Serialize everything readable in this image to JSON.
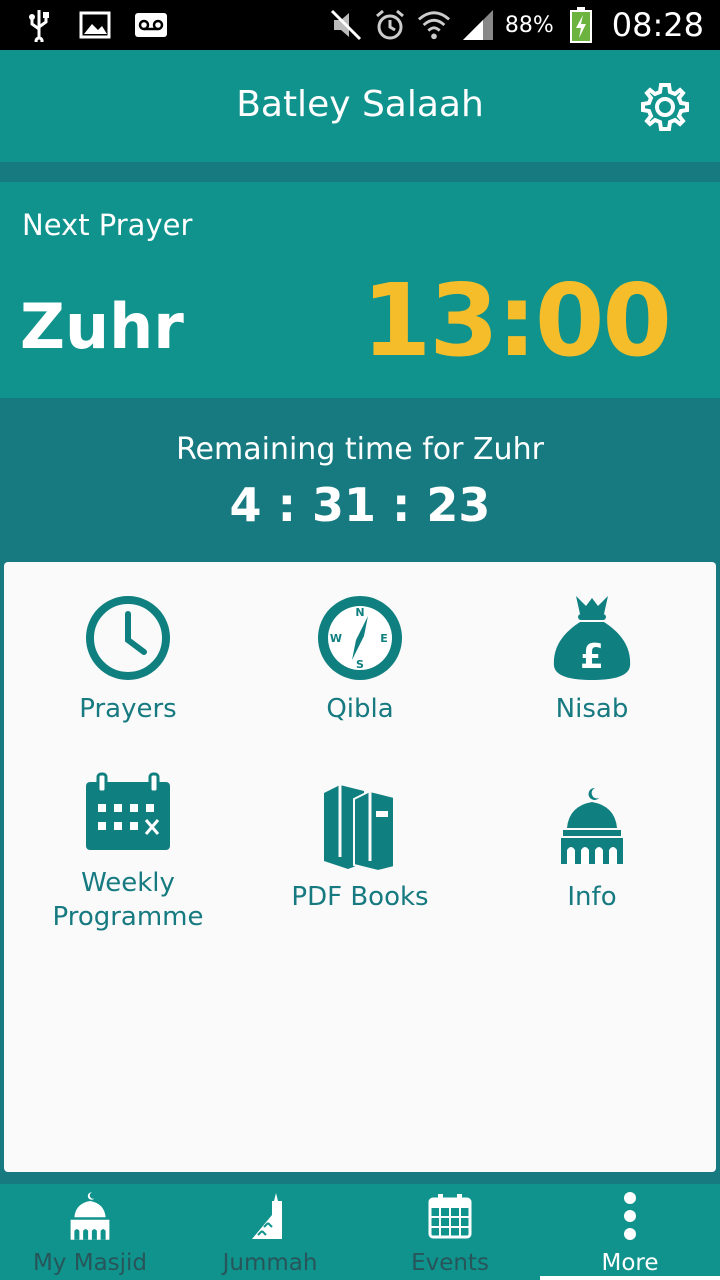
{
  "status_bar": {
    "battery": "88%",
    "time": "08:28",
    "left_icons": [
      "usb-icon",
      "image-icon",
      "voicemail-icon"
    ],
    "right_icons": [
      "mute-icon",
      "alarm-icon",
      "wifi-icon",
      "signal-icon",
      "battery-charging-icon"
    ]
  },
  "app_bar": {
    "title": "Batley Salaah",
    "settings_icon": "gear-icon"
  },
  "next_prayer": {
    "label": "Next Prayer",
    "name": "Zuhr",
    "time": "13:00"
  },
  "remaining": {
    "label": "Remaining time for Zuhr",
    "time": "4 : 31 : 23"
  },
  "tiles": [
    {
      "label": "Prayers",
      "icon": "clock-icon"
    },
    {
      "label": "Qibla",
      "icon": "compass-icon"
    },
    {
      "label": "Nisab",
      "icon": "money-bag-icon"
    },
    {
      "label": "Weekly Programme",
      "icon": "calendar-icon"
    },
    {
      "label": "PDF Books",
      "icon": "books-icon"
    },
    {
      "label": "Info",
      "icon": "mosque-icon"
    }
  ],
  "bottom_nav": [
    {
      "label": "My Masjid",
      "icon": "mosque-icon"
    },
    {
      "label": "Jummah",
      "icon": "minbar-icon"
    },
    {
      "label": "Events",
      "icon": "calendar-icon"
    },
    {
      "label": "More",
      "icon": "more-vertical-icon",
      "active": true
    }
  ],
  "colors": {
    "primary": "#0f938c",
    "primary_dark": "#167a80",
    "accent": "#f6bd2b",
    "icon": "#0f7f80"
  }
}
